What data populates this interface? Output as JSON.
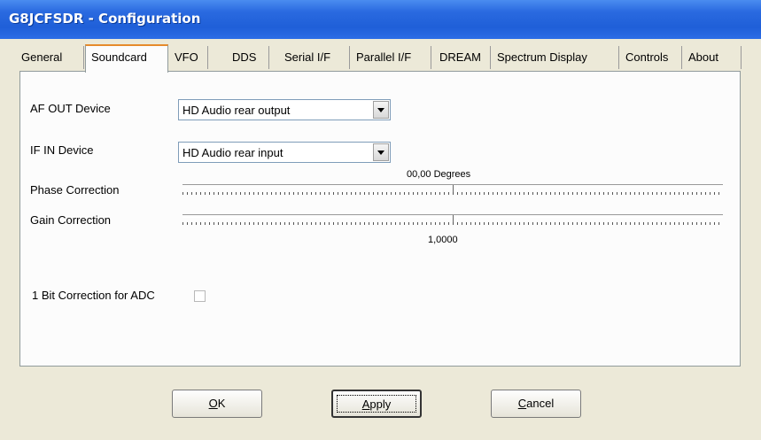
{
  "window": {
    "title": "G8JCFSDR - Configuration"
  },
  "tabs": [
    "General",
    "Soundcard",
    "VFO",
    "DDS",
    "Serial I/F",
    "Parallel I/F",
    "DREAM",
    "Spectrum Display",
    "Controls",
    "About"
  ],
  "active_tab": "Soundcard",
  "soundcard": {
    "af_out_label": "AF OUT Device",
    "af_out_value": "HD Audio rear output",
    "if_in_label": "IF IN Device",
    "if_in_value": "HD Audio rear input",
    "phase_label": "Phase Correction",
    "phase_value_text": "00,00 Degrees",
    "phase_position": 0.5,
    "gain_label": "Gain Correction",
    "gain_value_text": "1,0000",
    "gain_position": 0.5,
    "onebit_label": "1 Bit Correction for ADC",
    "onebit_checked": false
  },
  "buttons": {
    "ok_mnemonic": "O",
    "ok_rest": "K",
    "apply_mnemonic": "A",
    "apply_rest": "pply",
    "cancel_mnemonic": "C",
    "cancel_rest": "ancel"
  }
}
